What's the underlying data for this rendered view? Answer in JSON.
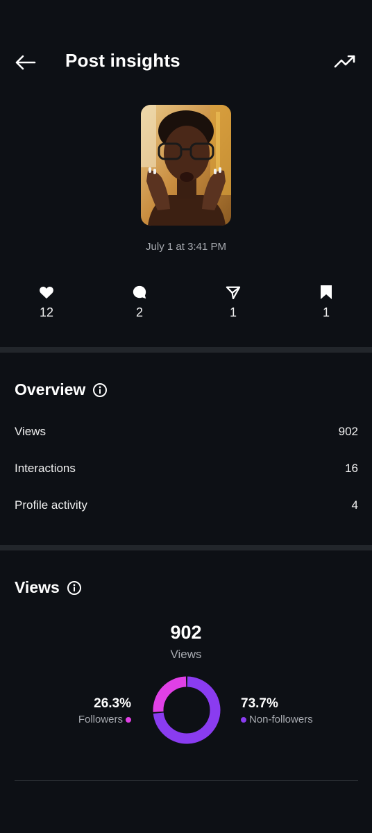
{
  "header": {
    "title": "Post insights",
    "back_icon": "arrow-left-icon",
    "trend_icon": "trending-up-icon"
  },
  "post": {
    "date": "July 1 at 3:41 PM"
  },
  "stats": [
    {
      "icon": "heart-icon",
      "count": "12"
    },
    {
      "icon": "comment-icon",
      "count": "2"
    },
    {
      "icon": "share-icon",
      "count": "1"
    },
    {
      "icon": "bookmark-icon",
      "count": "1"
    }
  ],
  "overview": {
    "title": "Overview",
    "rows": [
      {
        "label": "Views",
        "value": "902"
      },
      {
        "label": "Interactions",
        "value": "16"
      },
      {
        "label": "Profile activity",
        "value": "4"
      }
    ]
  },
  "views": {
    "title": "Views",
    "total": "902",
    "caption": "Views",
    "followers": {
      "percent": "26.3%",
      "label": "Followers",
      "color": "#e040e6"
    },
    "non_followers": {
      "percent": "73.7%",
      "label": "Non-followers",
      "color": "#8a3cf0"
    }
  },
  "chart_data": {
    "type": "pie",
    "categories": [
      "Followers",
      "Non-followers"
    ],
    "values": [
      26.3,
      73.7
    ],
    "colors": [
      "#e040e6",
      "#8a3cf0"
    ]
  }
}
